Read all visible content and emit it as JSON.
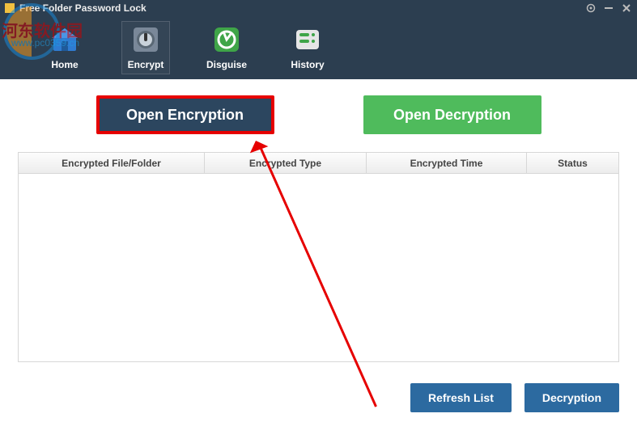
{
  "window": {
    "title": "Free Folder Password Lock"
  },
  "toolbar": {
    "items": [
      {
        "label": "Home"
      },
      {
        "label": "Encrypt"
      },
      {
        "label": "Disguise"
      },
      {
        "label": "History"
      }
    ]
  },
  "buttons": {
    "open_encryption": "Open Encryption",
    "open_decryption": "Open Decryption",
    "refresh_list": "Refresh List",
    "decryption": "Decryption"
  },
  "grid": {
    "columns": [
      "Encrypted File/Folder",
      "Encrypted Type",
      "Encrypted Time",
      "Status"
    ],
    "rows": []
  },
  "watermark": {
    "text": "河东软件园",
    "url": "www.pc0359.cn"
  },
  "colors": {
    "accent_blue": "#2c6aa0",
    "accent_green": "#4fbb5c",
    "highlight_red": "#e60000",
    "header_bg": "#2c3e50"
  }
}
